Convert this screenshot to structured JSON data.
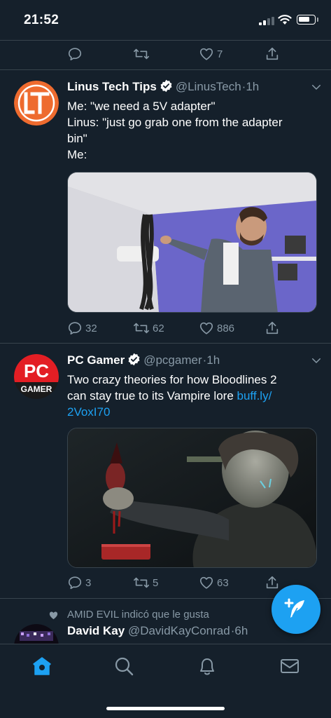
{
  "status_bar": {
    "time": "21:52",
    "battery_level": 0.75
  },
  "prev_tweet_actions": {
    "reply": "",
    "retweet": "",
    "like": "7"
  },
  "tweets": [
    {
      "name": "Linus Tech Tips",
      "handle": "@LinusTech",
      "dot": "·",
      "time": "1h",
      "verified": true,
      "text_lines": [
        "Me: \"we need a 5V adapter\"",
        "Linus: \"just go grab one from the adapter",
        "bin\"",
        "Me:"
      ],
      "link": "",
      "replies": "32",
      "retweets": "62",
      "likes": "886",
      "avatar_icon": "ltt-logo-icon"
    },
    {
      "name": "PC Gamer",
      "handle": "@pcgamer",
      "dot": "·",
      "time": "1h",
      "verified": true,
      "text_lines": [
        "Two crazy theories for how Bloodlines 2",
        "can stay true to its Vampire lore "
      ],
      "link_line1": "buff.ly/",
      "link_line2": "2VoxI70",
      "replies": "3",
      "retweets": "5",
      "likes": "63",
      "avatar_text_1": "PC",
      "avatar_text_2": "GAMER"
    },
    {
      "liked_by": "AMID EVIL indicó que le gusta",
      "name": "David Kay",
      "handle": "@DavidKayConrad",
      "dot": "·",
      "time": "6h"
    }
  ],
  "colors": {
    "background": "#15202b",
    "accent": "#1da1f2",
    "muted": "#8899a6",
    "divider": "#38444d"
  },
  "tabbar": {
    "items": [
      "home-icon",
      "search-icon",
      "bell-icon",
      "mail-icon"
    ],
    "active": "home-icon"
  }
}
